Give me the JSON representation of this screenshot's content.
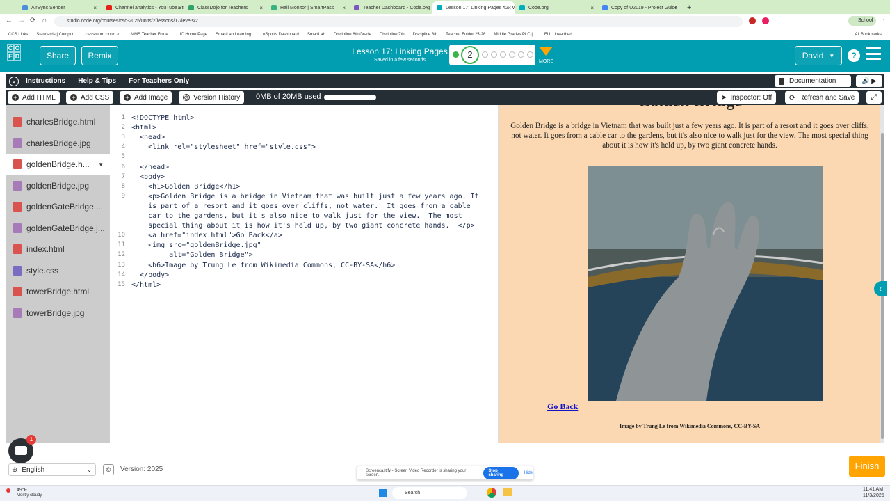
{
  "browser": {
    "tabs": [
      {
        "label": "AirSync Sender",
        "color": "#4a90d9"
      },
      {
        "label": "Channel analytics - YouTube Stu",
        "color": "#e62117"
      },
      {
        "label": "ClassDojo for Teachers",
        "color": "#31a36a"
      },
      {
        "label": "Hall Monitor | SmartPass",
        "color": "#36b37e"
      },
      {
        "label": "Teacher Dashboard - Code.org",
        "color": "#7e57c2"
      },
      {
        "label": "Lesson 17: Linking Pages #2 | W",
        "color": "#00adbc"
      },
      {
        "label": "Code.org",
        "color": "#00adbc"
      },
      {
        "label": "Copy of U2L19 - Project Guide",
        "color": "#4285f4"
      }
    ],
    "url": "studio.code.org/courses/csd-2025/units/2/lessons/17/levels/2",
    "profile": "School",
    "bookmarks": [
      "CCS Links",
      "Standards | Comput...",
      "classroom.cloud >...",
      "MMS Teacher Folde...",
      "IC Home Page",
      "SmartLab Learning...",
      "eSports Dashboard",
      "SmartLab",
      "Discipline 6th Grade",
      "Discipline 7th",
      "Discipline 8th",
      "Teacher Folder 25-26",
      "Middle Grades PLC |...",
      "FLL Unearthed"
    ],
    "all_bookmarks": "All Bookmarks"
  },
  "header": {
    "logo_letters": [
      "C",
      "O",
      "D",
      "E"
    ],
    "share": "Share",
    "remix": "Remix",
    "lesson_title": "Lesson 17: Linking Pages",
    "saved": "Saved in a few seconds",
    "level": "2",
    "more": "MORE",
    "user": "David",
    "help": "?"
  },
  "instructions_bar": {
    "instructions": "Instructions",
    "help_tips": "Help & Tips",
    "for_teachers": "For Teachers Only",
    "documentation": "Documentation"
  },
  "toolbar": {
    "add_html": "Add HTML",
    "add_css": "Add CSS",
    "add_image": "Add Image",
    "version_history": "Version History",
    "storage": "0MB of 20MB used",
    "inspector": "Inspector: Off",
    "refresh": "Refresh and Save"
  },
  "files": [
    {
      "name": "charlesBridge.html",
      "type": "html"
    },
    {
      "name": "charlesBridge.jpg",
      "type": "image"
    },
    {
      "name": "goldenBridge.h...",
      "type": "html",
      "active": true
    },
    {
      "name": "goldenBridge.jpg",
      "type": "image"
    },
    {
      "name": "goldenGateBridge....",
      "type": "html"
    },
    {
      "name": "goldenGateBridge.j...",
      "type": "image"
    },
    {
      "name": "index.html",
      "type": "html"
    },
    {
      "name": "style.css",
      "type": "css"
    },
    {
      "name": "towerBridge.html",
      "type": "html"
    },
    {
      "name": "towerBridge.jpg",
      "type": "image"
    }
  ],
  "code_lines": [
    {
      "n": "1",
      "text": "<!DOCTYPE html>"
    },
    {
      "n": "2",
      "text": "<html>"
    },
    {
      "n": "3",
      "text": "  <head>"
    },
    {
      "n": "4",
      "text": "    <link rel=\"stylesheet\" href=\"style.css\">"
    },
    {
      "n": "5",
      "text": ""
    },
    {
      "n": "6",
      "text": "  </head>"
    },
    {
      "n": "7",
      "text": "  <body>"
    },
    {
      "n": "8",
      "text": "    <h1>Golden Bridge</h1>"
    },
    {
      "n": "9",
      "text": "    <p>Golden Bridge is a bridge in Vietnam that was built just a few years ago. It"
    },
    {
      "n": "",
      "text": "    is part of a resort and it goes over cliffs, not water.  It goes from a cable"
    },
    {
      "n": "",
      "text": "    car to the gardens, but it's also nice to walk just for the view.  The most"
    },
    {
      "n": "",
      "text": "    special thing about it is how it's held up, by two giant concrete hands.  </p>"
    },
    {
      "n": "10",
      "text": "    <a href=\"index.html\">Go Back</a>"
    },
    {
      "n": "11",
      "text": "    <img src=\"goldenBridge.jpg\""
    },
    {
      "n": "12",
      "text": "         alt=\"Golden Bridge\">"
    },
    {
      "n": "13",
      "text": "    <h6>Image by Trung Le from Wikimedia Commons, CC-BY-SA</h6>"
    },
    {
      "n": "14",
      "text": "  </body>"
    },
    {
      "n": "15",
      "text": "</html>"
    }
  ],
  "preview": {
    "h1": "Golden Bridge",
    "paragraph": "Golden Bridge is a bridge in Vietnam that was built just a few years ago. It is part of a resort and it goes over cliffs, not water. It goes from a cable car to the gardens, but it's also nice to walk just for the view. The most special thing about it is how it's held up, by two giant concrete hands.",
    "link": "Go Back",
    "credit": "Image by Trung Le from Wikimedia Commons, CC-BY-SA"
  },
  "footer": {
    "language": "English",
    "version": "Version: 2025",
    "finish": "Finish",
    "badge": "1"
  },
  "screencastify": {
    "message": "Screencastify - Screen Video Recorder is sharing your screen.",
    "stop": "Stop sharing",
    "hide": "Hide"
  },
  "taskbar": {
    "weather_temp": "49°F",
    "weather_desc": "Mostly cloudy",
    "search": "Search",
    "time": "11:41 AM",
    "date": "11/3/2025"
  }
}
